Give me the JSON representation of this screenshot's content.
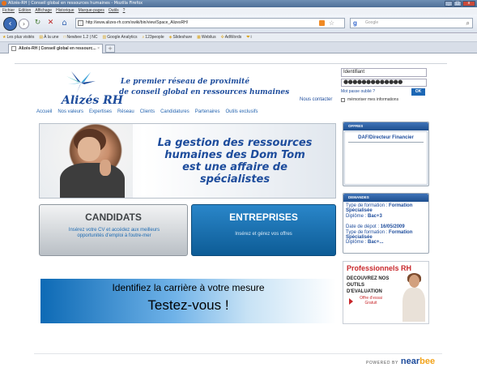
{
  "window": {
    "title": "Alizés-RH | Conseil global en ressources humaines - Mozilla Firefox",
    "controls": [
      "_",
      "□",
      "x"
    ]
  },
  "menu": [
    "Fichier",
    "Edition",
    "Affichage",
    "Historique",
    "Marque-pages",
    "Outils",
    "?"
  ],
  "browser": {
    "url": "http://www.alizes-rh.com/xwiki/bin/view/Space_AlizesRH/",
    "search_placeholder": "Google",
    "bookmarks": [
      "Les plus visités",
      "À la une",
      "Newbee 1.2 | NC",
      "Google Analytics",
      "123people",
      "Slideshare",
      "Webilus",
      "AdWords",
      "i"
    ],
    "tab_title": "Alizés-RH | Conseil global en ressourc..."
  },
  "header": {
    "logo": "Alizés RH",
    "tagline_1": "Le premier réseau de proximité",
    "tagline_2": "de conseil global en ressources humaines",
    "contact": "Nous contacter"
  },
  "login": {
    "identifiant": "Identifiant",
    "password_mask": "●●●●●●●●●●●●●",
    "forgot": "Mot passe oublié ?",
    "ok": "OK",
    "remember": "mémoriser mes informations"
  },
  "nav": [
    "Accueil",
    "Nos valeurs",
    "Expertises",
    "Réseau",
    "Clients",
    "Candidatures",
    "Partenaires",
    "Outils exclusifs"
  ],
  "hero": {
    "text": "La gestion des ressources humaines des Dom Tom est une affaire de spécialistes"
  },
  "candidats": {
    "title": "CANDIDATS",
    "sub": "Insérez votre CV et accédez aux meilleurs opportunités d'emploi à foutre-mer"
  },
  "entreprises": {
    "title": "ENTREPRISES",
    "sub": "Insérez et gérez vos offres"
  },
  "banner": {
    "line1": "Identifiez la carrière à votre mesure",
    "line2": "Testez-vous !"
  },
  "offres": {
    "title": "OFFRES",
    "items": [
      "DAF/Directeur Financier"
    ]
  },
  "demandes": {
    "title": "DEMANDES",
    "entries": [
      {
        "l1": "Type de formation : ",
        "b1": "Formation Spécialisée",
        "l2": "Diplôme : ",
        "b2": "Bac+3"
      },
      {
        "l0": "Date de dépot : ",
        "b0": "16/05/2009",
        "l1": "Type de formation : ",
        "b1": "Formation Spécialisée",
        "l2": "Diplôme : ",
        "b2": "Bac+..."
      }
    ]
  },
  "pub": {
    "title": "Professionnels RH",
    "ad": "DECOUVREZ NOS OUTILS D'EVALUATION",
    "offer": "Offre d'essai Gratuit"
  },
  "footer": {
    "powered": "POWERED BY",
    "brand_main": "near",
    "brand_accent": "bee"
  },
  "colors": {
    "brand_blue": "#1d4c9c",
    "link_blue": "#2464b0",
    "entreprises_blue": "#1a74b9",
    "accent_red": "#c8282c"
  }
}
